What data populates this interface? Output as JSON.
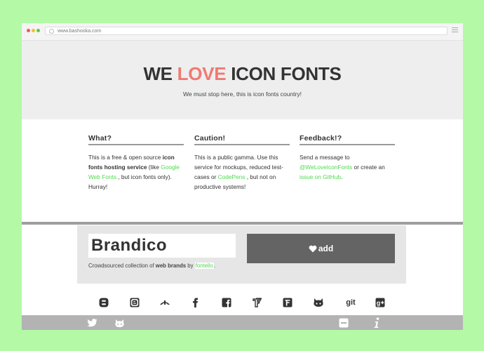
{
  "browser": {
    "url": "www.bashooka.com"
  },
  "hero": {
    "title_part1": "WE",
    "title_highlight": "LOVE",
    "title_part2": "ICON FONTS",
    "subtitle": "We must stop here, this is icon fonts country!",
    "accent": "#ef7a72"
  },
  "columns": [
    {
      "heading": "What?",
      "t1": "This is a free & open source ",
      "b1": "icon fonts hosting service",
      "t2": " (like ",
      "link1": "Google Web Fonts",
      "t3": " , but icon fonts only). Hurray!"
    },
    {
      "heading": "Caution!",
      "t1": "This is a public gamma. Use this service for mockups, reduced test-cases or ",
      "link1": "CodePens",
      "t2": " , but not on productive systems!"
    },
    {
      "heading": "Feedback!?",
      "t1": "Send a message to ",
      "link1": "@WeLoveIconFonts",
      "t2": " or create an ",
      "link2": "issue on GitHub",
      "t3": "."
    }
  ],
  "font_card": {
    "name": "Brandico",
    "add_label": "add",
    "desc_prefix": "Crowdsourced collection of ",
    "desc_bold": "web brands",
    "desc_mid": " by ",
    "desc_link": "fontello",
    "desc_suffix": "."
  },
  "glyph_icons": [
    "blogger-rect-icon",
    "blogger-icon",
    "deviantart-icon",
    "facebook-icon",
    "facebook-rect-icon",
    "friendfeed-icon",
    "friendfeed-rect-icon",
    "github-icon",
    "git-text-icon",
    "googleplus-rect-icon"
  ],
  "git_text": "git",
  "bottom_icons": [
    "twitter-icon",
    "github-cat-icon",
    "minus-rect-icon",
    "info-icon"
  ],
  "colors": {
    "link": "#4bdc4b",
    "background": "#b4f9a5",
    "button": "#646464"
  }
}
